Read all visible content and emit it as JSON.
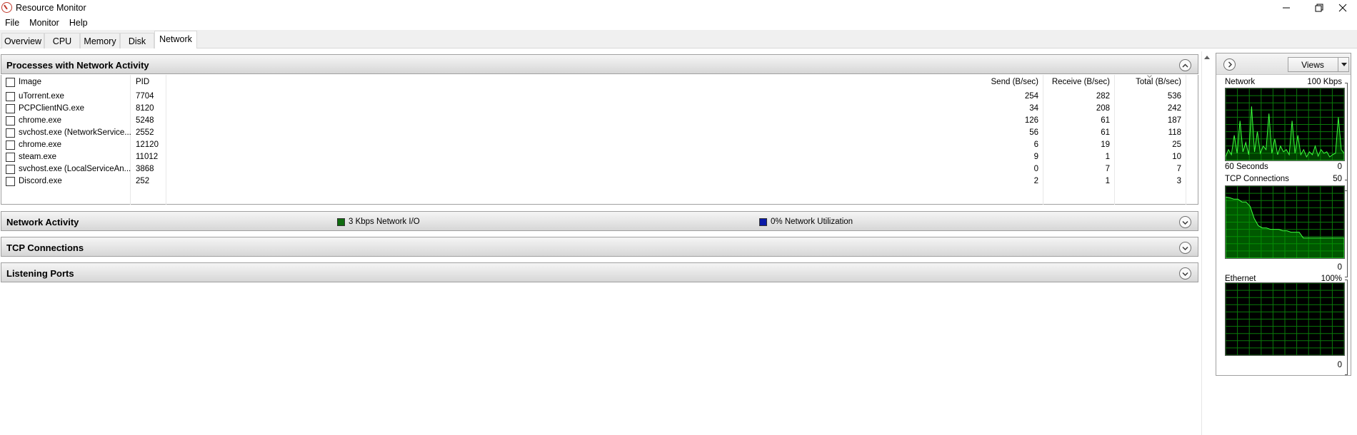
{
  "window": {
    "title": "Resource Monitor",
    "icon": "resource-monitor-icon"
  },
  "menu": [
    "File",
    "Monitor",
    "Help"
  ],
  "tabs": [
    "Overview",
    "CPU",
    "Memory",
    "Disk",
    "Network"
  ],
  "active_tab": "Network",
  "processes": {
    "title": "Processes with Network Activity",
    "columns": [
      "Image",
      "PID",
      "Send (B/sec)",
      "Receive (B/sec)",
      "Total (B/sec)"
    ],
    "rows": [
      {
        "image": "uTorrent.exe",
        "pid": "7704",
        "send": "254",
        "receive": "282",
        "total": "536"
      },
      {
        "image": "PCPClientNG.exe",
        "pid": "8120",
        "send": "34",
        "receive": "208",
        "total": "242"
      },
      {
        "image": "chrome.exe",
        "pid": "5248",
        "send": "126",
        "receive": "61",
        "total": "187"
      },
      {
        "image": "svchost.exe (NetworkService...",
        "pid": "2552",
        "send": "56",
        "receive": "61",
        "total": "118"
      },
      {
        "image": "chrome.exe",
        "pid": "12120",
        "send": "6",
        "receive": "19",
        "total": "25"
      },
      {
        "image": "steam.exe",
        "pid": "11012",
        "send": "9",
        "receive": "1",
        "total": "10"
      },
      {
        "image": "svchost.exe (LocalServiceAn...",
        "pid": "3868",
        "send": "0",
        "receive": "7",
        "total": "7"
      },
      {
        "image": "Discord.exe",
        "pid": "252",
        "send": "2",
        "receive": "1",
        "total": "3"
      }
    ]
  },
  "network_activity": {
    "title": "Network Activity",
    "io_label": "3 Kbps Network I/O",
    "io_color": "#0f6b0f",
    "util_label": "0% Network Utilization",
    "util_color": "#0a1aa8"
  },
  "tcp_connections": {
    "title": "TCP Connections"
  },
  "listening_ports": {
    "title": "Listening Ports"
  },
  "side_panel": {
    "views_label": "Views",
    "graphs": [
      {
        "name": "Network",
        "max": "100 Kbps",
        "footer_left": "60 Seconds",
        "footer_right": "0"
      },
      {
        "name": "TCP Connections",
        "max": "50",
        "footer_left": "",
        "footer_right": "0"
      },
      {
        "name": "Ethernet",
        "max": "100%",
        "footer_left": "",
        "footer_right": "0"
      }
    ]
  }
}
